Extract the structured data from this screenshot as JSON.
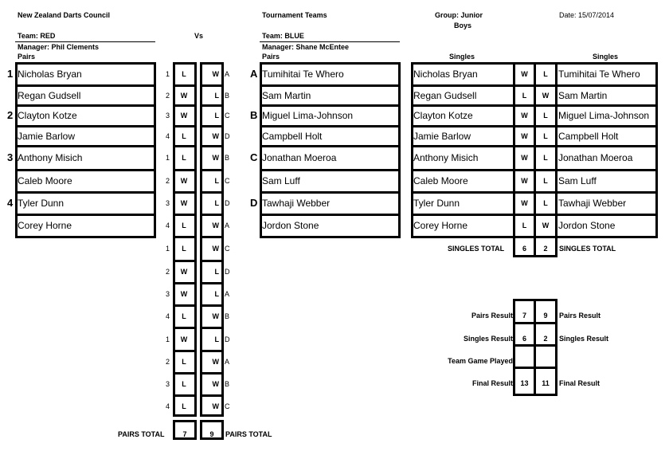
{
  "header": {
    "org": "New Zealand Darts Council",
    "title": "Tournament Teams",
    "group": "Group:  Junior",
    "group2": "Boys",
    "date": "Date: 15/07/2014",
    "vs": "Vs"
  },
  "home": {
    "team": "Team:  RED",
    "manager": "Manager: Phil Clements",
    "section": "Pairs",
    "pair_numbers": [
      "1",
      "2",
      "3",
      "4"
    ],
    "players": [
      "Nicholas Bryan",
      "Regan Gudsell",
      "Clayton Kotze",
      "Jamie Barlow",
      "Anthony Misich",
      "Caleb Moore",
      "Tyler Dunn",
      "Corey Horne"
    ]
  },
  "away": {
    "team": "Team: BLUE",
    "manager": "Manager: Shane McEntee",
    "section": "Pairs",
    "pair_letters": [
      "A",
      "B",
      "C",
      "D"
    ],
    "players": [
      "Tumihitai Te Whero",
      "Sam Martin",
      "Miguel Lima-Johnson",
      "Campbell Holt",
      "Jonathan Moeroa",
      "Sam Luff",
      "Tawhaji Webber",
      "Jordon Stone"
    ]
  },
  "pairs_games": [
    {
      "home_no": "1",
      "home": "L",
      "away": "W",
      "away_letter": "A"
    },
    {
      "home_no": "2",
      "home": "W",
      "away": "L",
      "away_letter": "B"
    },
    {
      "home_no": "3",
      "home": "W",
      "away": "L",
      "away_letter": "C"
    },
    {
      "home_no": "4",
      "home": "L",
      "away": "W",
      "away_letter": "D"
    },
    {
      "home_no": "1",
      "home": "L",
      "away": "W",
      "away_letter": "B"
    },
    {
      "home_no": "2",
      "home": "W",
      "away": "L",
      "away_letter": "C"
    },
    {
      "home_no": "3",
      "home": "W",
      "away": "L",
      "away_letter": "D"
    },
    {
      "home_no": "4",
      "home": "L",
      "away": "W",
      "away_letter": "A"
    },
    {
      "home_no": "1",
      "home": "L",
      "away": "W",
      "away_letter": "C"
    },
    {
      "home_no": "2",
      "home": "W",
      "away": "L",
      "away_letter": "D"
    },
    {
      "home_no": "3",
      "home": "W",
      "away": "L",
      "away_letter": "A"
    },
    {
      "home_no": "4",
      "home": "L",
      "away": "W",
      "away_letter": "B"
    },
    {
      "home_no": "1",
      "home": "W",
      "away": "L",
      "away_letter": "D"
    },
    {
      "home_no": "2",
      "home": "L",
      "away": "W",
      "away_letter": "A"
    },
    {
      "home_no": "3",
      "home": "L",
      "away": "W",
      "away_letter": "B"
    },
    {
      "home_no": "4",
      "home": "L",
      "away": "W",
      "away_letter": "C"
    }
  ],
  "pairs_total": {
    "label": "PAIRS TOTAL",
    "home": "7",
    "away": "9"
  },
  "singles": {
    "header_home": "Singles",
    "header_away": "Singles",
    "rows": [
      {
        "home": "Nicholas Bryan",
        "h": "W",
        "a": "L",
        "away": "Tumihitai Te Whero"
      },
      {
        "home": "Regan Gudsell",
        "h": "L",
        "a": "W",
        "away": "Sam Martin"
      },
      {
        "home": "Clayton Kotze",
        "h": "W",
        "a": "L",
        "away": "Miguel Lima-Johnson"
      },
      {
        "home": "Jamie Barlow",
        "h": "W",
        "a": "L",
        "away": "Campbell Holt"
      },
      {
        "home": "Anthony Misich",
        "h": "W",
        "a": "L",
        "away": "Jonathan Moeroa"
      },
      {
        "home": "Caleb Moore",
        "h": "W",
        "a": "L",
        "away": "Sam Luff"
      },
      {
        "home": "Tyler Dunn",
        "h": "W",
        "a": "L",
        "away": "Tawhaji Webber"
      },
      {
        "home": "Corey Horne",
        "h": "L",
        "a": "W",
        "away": "Jordon Stone"
      }
    ],
    "total": {
      "label": "SINGLES TOTAL",
      "home": "6",
      "away": "2"
    }
  },
  "results": [
    {
      "label": "Pairs Result",
      "home": "7",
      "away": "9",
      "label_right": "Pairs Result"
    },
    {
      "label": "Singles Result",
      "home": "6",
      "away": "2",
      "label_right": "Singles Result"
    },
    {
      "label": "Team Game Played",
      "home": "",
      "away": "",
      "label_right": ""
    },
    {
      "label": "Final Result",
      "home": "13",
      "away": "11",
      "label_right": "Final Result"
    }
  ]
}
